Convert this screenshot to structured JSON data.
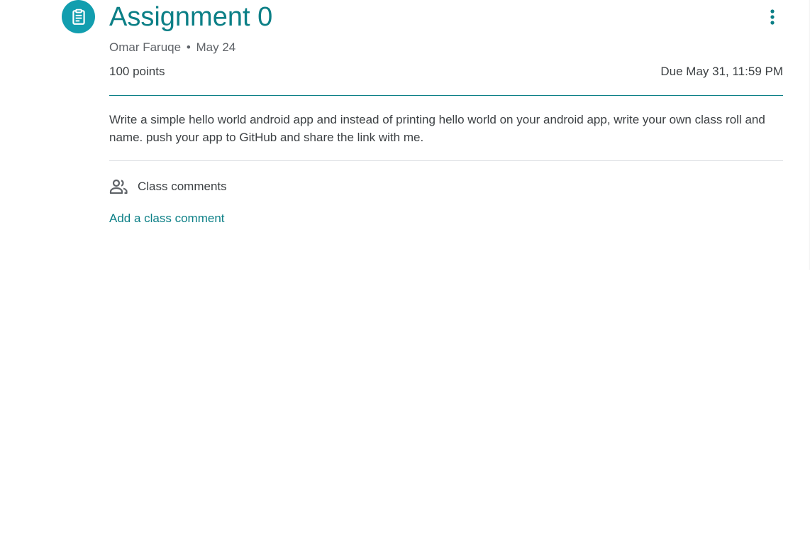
{
  "assignment": {
    "title": "Assignment 0",
    "author": "Omar Faruqe",
    "separator": "•",
    "posted_date": "May 24",
    "points": "100 points",
    "due": "Due May 31, 11:59 PM",
    "description": "Write a simple hello world android app and instead of printing hello world on your android app, write your own class roll and name. push your app to GitHub and share the link with me."
  },
  "comments": {
    "header_label": "Class comments",
    "add_label": "Add a class comment"
  },
  "icons": {
    "type_icon": "assignment-clipboard-icon",
    "more_icon": "more-vert-icon",
    "people_icon": "people-icon"
  },
  "colors": {
    "accent": "#0b7f86",
    "icon_bg": "#129eaf",
    "text": "#3c4043",
    "muted": "#5f6368",
    "divider": "#dadce0"
  }
}
